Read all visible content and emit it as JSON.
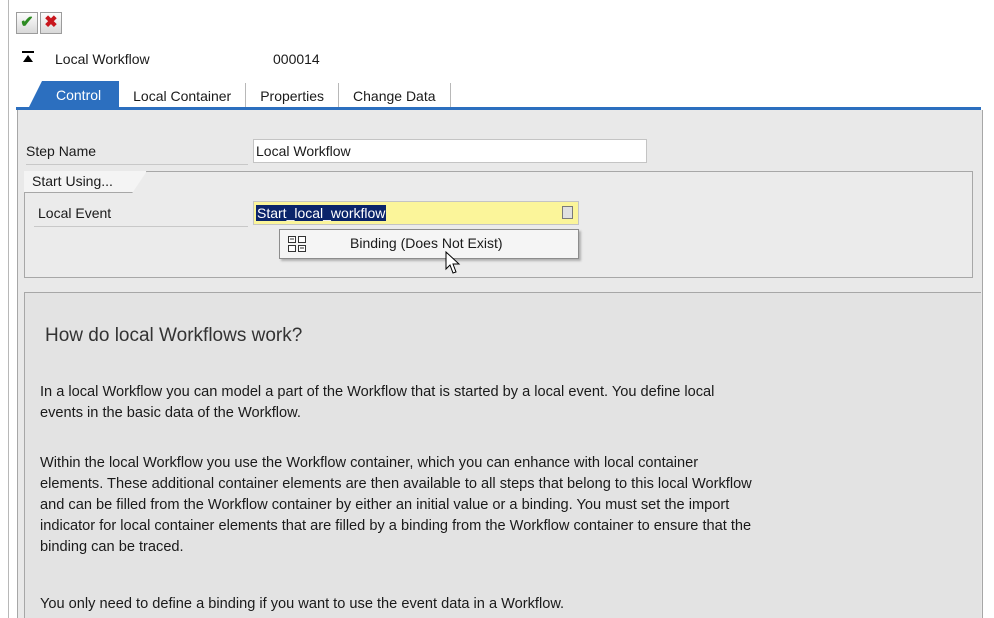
{
  "toolbar": {
    "icons": [
      "check-icon",
      "cancel-icon"
    ],
    "ok_glyph": "✔",
    "cancel_glyph": "✖"
  },
  "header": {
    "title": "Local Workflow",
    "number": "000014"
  },
  "tabs": [
    {
      "label": "Control",
      "active": true
    },
    {
      "label": "Local Container",
      "active": false
    },
    {
      "label": "Properties",
      "active": false
    },
    {
      "label": "Change Data",
      "active": false
    }
  ],
  "form": {
    "step_name_label": "Step Name",
    "step_name_value": "Local Workflow",
    "group_title": "Start Using...",
    "local_event_label": "Local Event",
    "local_event_value": "Start_local_workflow"
  },
  "context_menu": {
    "item_label": "Binding (Does Not Exist)"
  },
  "help": {
    "title": "How do local Workflows work?",
    "p1_line1": "In a local Workflow you can model a part of the Workflow that is started by a local event. You define local",
    "p1_line2": "events in the basic data of the Workflow.",
    "p2_line1": "Within the local Workflow you use the Workflow container, which you can enhance with local container",
    "p2_line2": "elements. These additional container elements are then available to all steps that belong to this local Workflow",
    "p2_line3": "and can be filled from the Workflow container by either an initial value or a binding. You must set the import",
    "p2_line4": "indicator for local container elements that are filled by a binding from the Workflow container to ensure that the",
    "p2_line5": "binding can be traced.",
    "p3_line1": "You only need to define a binding if you want to use the event data in a Workflow."
  },
  "colors": {
    "tab_active": "#2c6fbf",
    "event_field": "#fbf59a",
    "selection": "#0a246a"
  }
}
